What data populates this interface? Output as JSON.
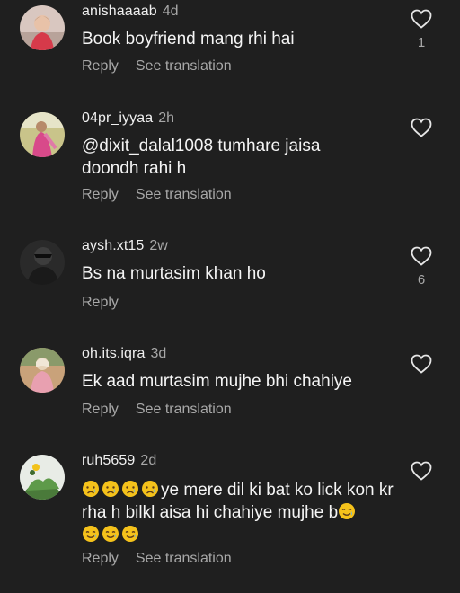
{
  "comments": [
    {
      "username": "anishaaaab",
      "time": "4d",
      "text": "Book boyfriend mang rhi hai",
      "reply": "Reply",
      "translate": "See translation",
      "likes": "1"
    },
    {
      "username": "04pr_iyyaa",
      "time": "2h",
      "text": "@dixit_dalal1008 tumhare jaisa doondh rahi h",
      "reply": "Reply",
      "translate": "See translation",
      "likes": ""
    },
    {
      "username": "aysh.xt15",
      "time": "2w",
      "text": "Bs na murtasim khan ho",
      "reply": "Reply",
      "translate": "",
      "likes": "6"
    },
    {
      "username": "oh.its.iqra",
      "time": "3d",
      "text": "Ek aad murtasim mujhe bhi chahiye",
      "reply": "Reply",
      "translate": "See translation",
      "likes": ""
    },
    {
      "username": "ruh5659",
      "time": "2d",
      "text_main": "ye mere dil ki bat ko lick kon kr rha h bilkl aisa hi chahiye mujhe b",
      "reply": "Reply",
      "translate": "See translation",
      "likes": ""
    }
  ],
  "icons": {
    "like": "heart-outline-icon",
    "emoji_cry": "crying-face-emoji",
    "emoji_smile_tear": "smiling-face-with-tear-emoji"
  },
  "colors": {
    "background": "#1f1f1f",
    "text": "#f5f5f5",
    "muted": "#a8a8a8"
  }
}
